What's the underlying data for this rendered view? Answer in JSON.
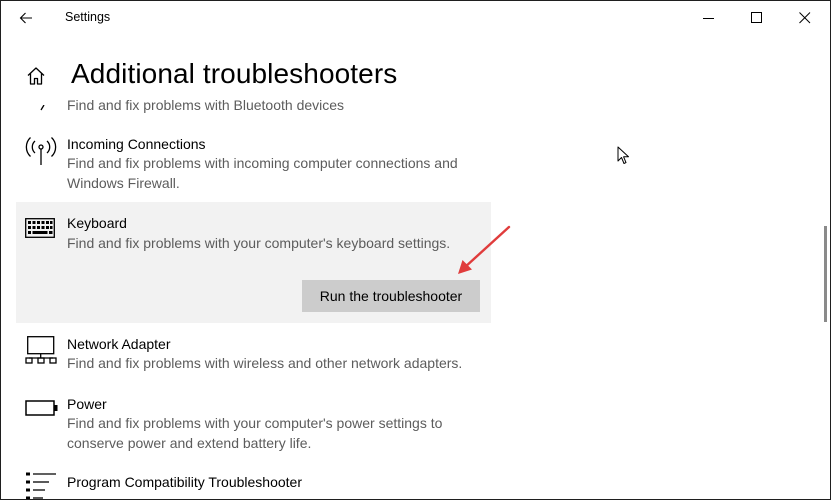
{
  "window": {
    "app_title": "Settings",
    "back_icon": "back-arrow-icon",
    "minimize_icon": "minimize-icon",
    "maximize_icon": "maximize-icon",
    "close_icon": "close-icon"
  },
  "header": {
    "home_icon": "home-icon",
    "title": "Additional troubleshooters"
  },
  "troubleshooters": [
    {
      "name": "",
      "description": "Find and fix problems with Bluetooth devices",
      "icon": "bluetooth-icon"
    },
    {
      "name": "Incoming Connections",
      "description": "Find and fix problems with incoming computer connections and Windows Firewall.",
      "icon": "antenna-icon"
    },
    {
      "name": "Keyboard",
      "description": "Find and fix problems with your computer's keyboard settings.",
      "icon": "keyboard-icon",
      "selected": true,
      "run_button_label": "Run the troubleshooter"
    },
    {
      "name": "Network Adapter",
      "description": "Find and fix problems with wireless and other network adapters.",
      "icon": "network-adapter-icon"
    },
    {
      "name": "Power",
      "description": "Find and fix problems with your computer's power settings to conserve power and extend battery life.",
      "icon": "battery-icon"
    },
    {
      "name": "Program Compatibility Troubleshooter",
      "description": "",
      "icon": "program-list-icon"
    }
  ],
  "colors": {
    "selected_background": "#f2f2f2",
    "button_background": "#cccccc",
    "description_text": "#5c5c5c",
    "annotation_arrow": "#e03c3c"
  }
}
